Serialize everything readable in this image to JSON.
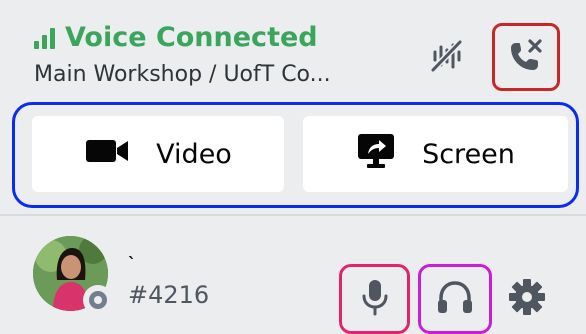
{
  "voice": {
    "status_text": "Voice Connected",
    "channel_text": "Main Workshop / UofT Co...",
    "status_color": "#3ba55c"
  },
  "buttons": {
    "video_label": "Video",
    "screen_label": "Screen"
  },
  "user": {
    "name": "`",
    "discriminator": "#4216",
    "status": "offline"
  },
  "icons": {
    "signal": "signal-bars-icon",
    "noise_suppression": "noise-suppression-icon",
    "disconnect": "phone-disconnect-icon",
    "video": "video-camera-icon",
    "screen": "screen-share-icon",
    "microphone": "microphone-icon",
    "headphones": "headphones-icon",
    "settings": "gear-icon"
  },
  "highlight_colors": {
    "disconnect": "#c62828",
    "media_buttons": "#0a2cf0",
    "microphone": "#e0246e",
    "headphones": "#c81ed8"
  }
}
